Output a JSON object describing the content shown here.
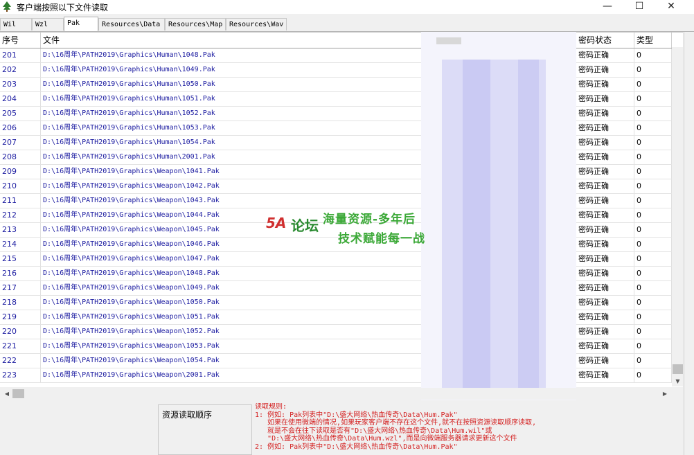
{
  "window": {
    "title": "客户端按照以下文件读取",
    "minimize": "—",
    "maximize": "☐",
    "close": "✕"
  },
  "tabs": [
    {
      "label": "Wil",
      "active": false
    },
    {
      "label": "Wzl",
      "active": false
    },
    {
      "label": "Pak",
      "active": true
    },
    {
      "label": "Resources\\Data",
      "active": false
    },
    {
      "label": "Resources\\Map",
      "active": false
    },
    {
      "label": "Resources\\Wav",
      "active": false
    }
  ],
  "grid": {
    "headers": {
      "index": "序号",
      "file": "文件",
      "status": "密码状态",
      "type": "类型"
    },
    "rows": [
      {
        "index": "201",
        "file": "D:\\16周年\\PATH2019\\Graphics\\Human\\1048.Pak",
        "status": "密码正确",
        "type": "0"
      },
      {
        "index": "202",
        "file": "D:\\16周年\\PATH2019\\Graphics\\Human\\1049.Pak",
        "status": "密码正确",
        "type": "0"
      },
      {
        "index": "203",
        "file": "D:\\16周年\\PATH2019\\Graphics\\Human\\1050.Pak",
        "status": "密码正确",
        "type": "0"
      },
      {
        "index": "204",
        "file": "D:\\16周年\\PATH2019\\Graphics\\Human\\1051.Pak",
        "status": "密码正确",
        "type": "0"
      },
      {
        "index": "205",
        "file": "D:\\16周年\\PATH2019\\Graphics\\Human\\1052.Pak",
        "status": "密码正确",
        "type": "0"
      },
      {
        "index": "206",
        "file": "D:\\16周年\\PATH2019\\Graphics\\Human\\1053.Pak",
        "status": "密码正确",
        "type": "0"
      },
      {
        "index": "207",
        "file": "D:\\16周年\\PATH2019\\Graphics\\Human\\1054.Pak",
        "status": "密码正确",
        "type": "0"
      },
      {
        "index": "208",
        "file": "D:\\16周年\\PATH2019\\Graphics\\Human\\2001.Pak",
        "status": "密码正确",
        "type": "0"
      },
      {
        "index": "209",
        "file": "D:\\16周年\\PATH2019\\Graphics\\Weapon\\1041.Pak",
        "status": "密码正确",
        "type": "0"
      },
      {
        "index": "210",
        "file": "D:\\16周年\\PATH2019\\Graphics\\Weapon\\1042.Pak",
        "status": "密码正确",
        "type": "0"
      },
      {
        "index": "211",
        "file": "D:\\16周年\\PATH2019\\Graphics\\Weapon\\1043.Pak",
        "status": "密码正确",
        "type": "0"
      },
      {
        "index": "212",
        "file": "D:\\16周年\\PATH2019\\Graphics\\Weapon\\1044.Pak",
        "status": "密码正确",
        "type": "0"
      },
      {
        "index": "213",
        "file": "D:\\16周年\\PATH2019\\Graphics\\Weapon\\1045.Pak",
        "status": "密码正确",
        "type": "0"
      },
      {
        "index": "214",
        "file": "D:\\16周年\\PATH2019\\Graphics\\Weapon\\1046.Pak",
        "status": "密码正确",
        "type": "0"
      },
      {
        "index": "215",
        "file": "D:\\16周年\\PATH2019\\Graphics\\Weapon\\1047.Pak",
        "status": "密码正确",
        "type": "0"
      },
      {
        "index": "216",
        "file": "D:\\16周年\\PATH2019\\Graphics\\Weapon\\1048.Pak",
        "status": "密码正确",
        "type": "0"
      },
      {
        "index": "217",
        "file": "D:\\16周年\\PATH2019\\Graphics\\Weapon\\1049.Pak",
        "status": "密码正确",
        "type": "0"
      },
      {
        "index": "218",
        "file": "D:\\16周年\\PATH2019\\Graphics\\Weapon\\1050.Pak",
        "status": "密码正确",
        "type": "0"
      },
      {
        "index": "219",
        "file": "D:\\16周年\\PATH2019\\Graphics\\Weapon\\1051.Pak",
        "status": "密码正确",
        "type": "0"
      },
      {
        "index": "220",
        "file": "D:\\16周年\\PATH2019\\Graphics\\Weapon\\1052.Pak",
        "status": "密码正确",
        "type": "0"
      },
      {
        "index": "221",
        "file": "D:\\16周年\\PATH2019\\Graphics\\Weapon\\1053.Pak",
        "status": "密码正确",
        "type": "0"
      },
      {
        "index": "222",
        "file": "D:\\16周年\\PATH2019\\Graphics\\Weapon\\1054.Pak",
        "status": "密码正确",
        "type": "0"
      },
      {
        "index": "223",
        "file": "D:\\16周年\\PATH2019\\Graphics\\Weapon\\2001.Pak",
        "status": "密码正确",
        "type": "0"
      }
    ]
  },
  "watermark": {
    "logo": "5A",
    "logo_cn": "论坛",
    "line1": "海量资源-多年后",
    "line2": "技术赋能每一战"
  },
  "bottom": {
    "order_title": "资源读取顺序",
    "rules": "读取规则:\n1: 例如: Pak列表中\"D:\\盛大网络\\热血传奇\\Data\\Hum.Pak\"\n   如果在使用微端的情况,如果玩家客户端不存在这个文件,就不在按照资源读取顺序读取,\n   就是不会在往下读取是否有\"D:\\盛大网络\\热血传奇\\Data\\Hum.wil\"或\n   \"D:\\盛大网络\\热血传奇\\Data\\Hum.wzl\",而是向微端服务器请求更新这个文件\n2: 例如: Pak列表中\"D:\\盛大网络\\热血传奇\\Data\\Hum.Pak\""
  },
  "colors": {
    "row_text": "#1a1aa0",
    "rules_text": "#d42020",
    "watermark_green": "#3aa836"
  }
}
